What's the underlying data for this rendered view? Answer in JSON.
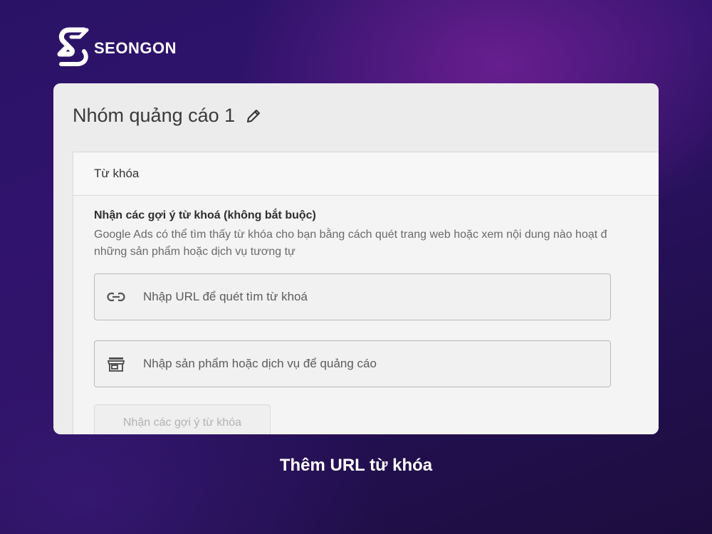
{
  "brand": {
    "name": "SEONGON"
  },
  "panel": {
    "title": "Nhóm quảng cáo 1",
    "card": {
      "header": "Từ khóa",
      "section_title": "Nhận các gợi ý từ khoá (không bắt buộc)",
      "description_line1": "Google Ads có thể tìm thấy từ khóa cho bạn bằng cách quét trang web hoặc xem nội dung nào hoạt đ",
      "description_line2": "những sản phẩm hoặc dịch vụ tương tự",
      "url_field": {
        "placeholder": "Nhập URL để quét tìm từ khoá",
        "value": "",
        "icon": "link-icon"
      },
      "product_field": {
        "placeholder": "Nhập sản phẩm hoặc dịch vụ để quảng cáo",
        "value": "",
        "icon": "store-icon"
      },
      "suggest_button": "Nhận các gợi ý từ khóa"
    }
  },
  "caption": "Thêm URL từ khóa",
  "colors": {
    "background": "#2a1366",
    "panel": "#ececec",
    "accent": "#9b2fa8"
  }
}
